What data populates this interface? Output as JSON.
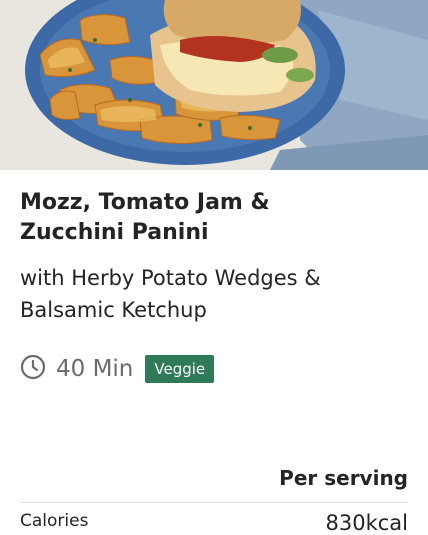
{
  "hero": {
    "image_alt": "Mozzarella panini with potato wedges on a blue plate"
  },
  "recipe": {
    "title": "Mozz, Tomato Jam & Zucchini Panini",
    "subtitle": "with Herby Potato Wedges & Balsamic Ketchup",
    "duration": "40 Min",
    "tag": "Veggie"
  },
  "colors": {
    "tag_bg": "#2f7a57",
    "text": "#242424",
    "muted": "#6b6b6b"
  },
  "nutrition": {
    "header": "Per serving",
    "rows": [
      {
        "label": "Calories",
        "value": "830kcal"
      }
    ]
  }
}
